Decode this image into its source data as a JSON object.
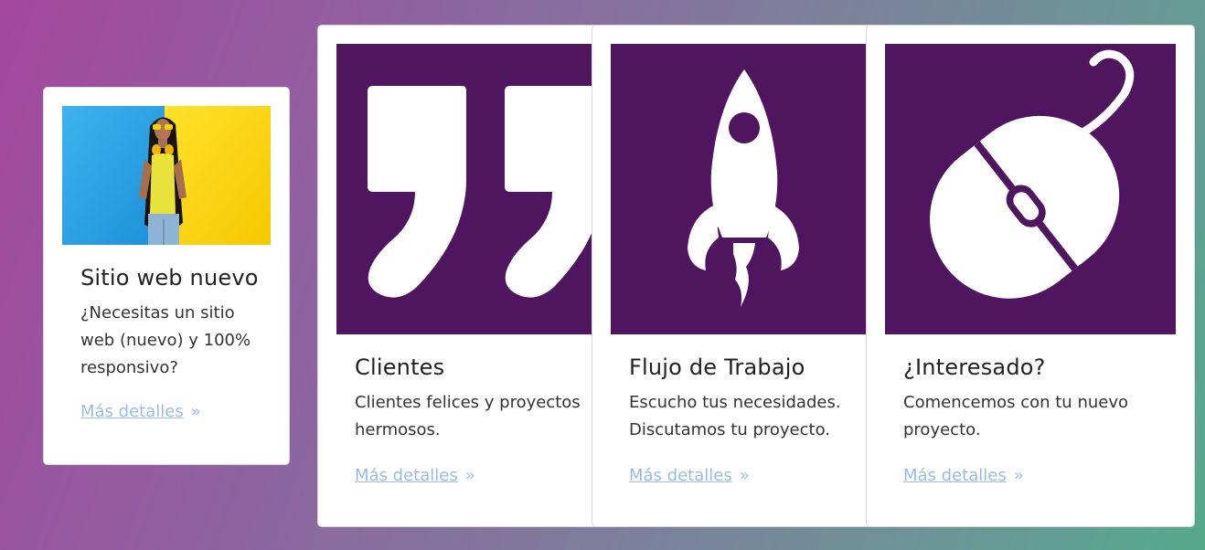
{
  "cards": [
    {
      "title": "Sitio web nuevo",
      "text": "¿Necesitas un sitio web (nuevo) y 100% responsivo?",
      "link": "Más detalles",
      "image": "woman-photo"
    },
    {
      "title": "Clientes",
      "text": "Clientes felices y proyectos hermosos.",
      "link": "Más detalles",
      "icon": "quote-icon"
    },
    {
      "title": "Flujo de Trabajo",
      "text": "Escucho tus necesidades. Discutamos tu proyecto.",
      "link": "Más detalles",
      "icon": "rocket-icon"
    },
    {
      "title": "¿Interesado?",
      "text": "Comencemos con tu nuevo proyecto.",
      "link": "Más detalles",
      "icon": "mouse-icon"
    }
  ],
  "colors": {
    "tile_purple": "#50155f",
    "link": "#9bbbe6"
  },
  "link_chevron": "»"
}
